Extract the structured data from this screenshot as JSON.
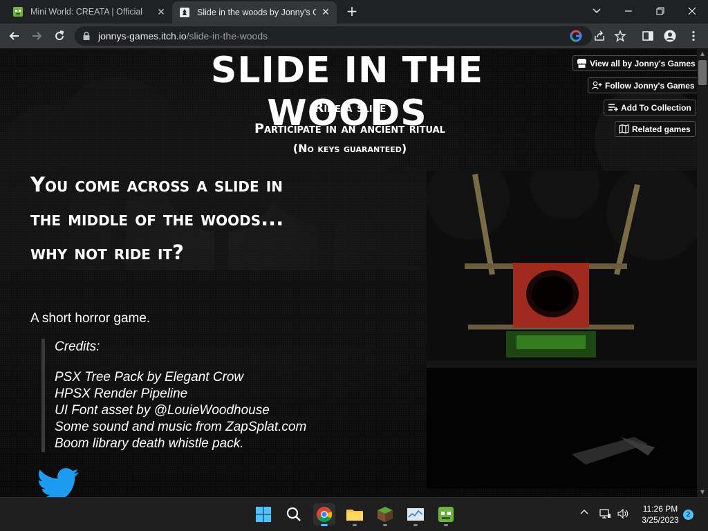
{
  "browser": {
    "tabs": [
      {
        "title": "Mini World: CREATA | Official"
      },
      {
        "title": "Slide in the woods by Jonny's Games"
      }
    ],
    "new_tab": "+",
    "url_domain": "jonnys-games.itch.io",
    "url_path": "/slide-in-the-woods"
  },
  "page": {
    "title": "SLIDE IN THE WOODS",
    "tagline1": "Ride a slide",
    "tagline2": "Participate in an ancient ritual",
    "tagline3": "(No keys guaranteed)",
    "intro_lines": [
      "You come across a slide in",
      "the middle of the woods...",
      "why not ride it?"
    ],
    "short_desc": "A short horror game.",
    "credits_heading": "Credits:",
    "credits": [
      "PSX Tree Pack by Elegant Crow",
      "HPSX Render Pipeline",
      "UI Font asset by @LouieWoodhouse",
      "Some sound and music from ZapSplat.com",
      "Boom library death whistle pack."
    ]
  },
  "itch_buttons": {
    "view_all": "View all by Jonny's Games",
    "follow": "Follow Jonny's Games",
    "collection": "Add To Collection",
    "related": "Related games"
  },
  "taskbar": {
    "time": "11:26 PM",
    "date": "3/25/2023",
    "notifications": "2"
  },
  "colors": {
    "accent": "#4cc2ff",
    "tab_active": "#35363a",
    "tab_strip": "#202124",
    "page_bg": "#0a0a0a",
    "slide_red": "#a02a20"
  }
}
